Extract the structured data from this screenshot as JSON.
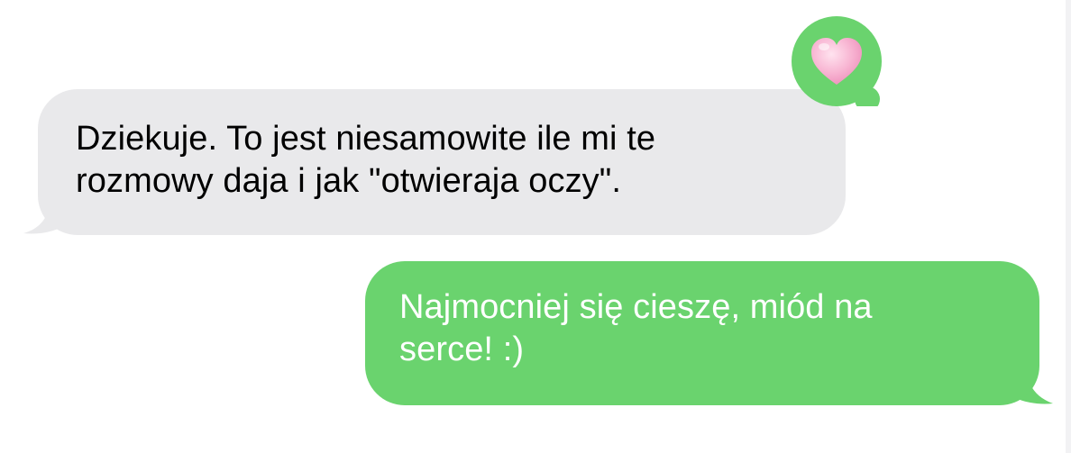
{
  "conversation": {
    "incoming_message": {
      "lines": [
        "Dziekuje. To jest niesamowite ile mi te",
        "rozmowy daja i jak \"otwieraja oczy\"."
      ],
      "bubble_color": "#e9e9eb",
      "text_color": "#000000"
    },
    "outgoing_message": {
      "lines": [
        "Najmocniej się cieszę, miód na",
        "serce! :)"
      ],
      "bubble_color": "#6ad36e",
      "text_color": "#ffffff"
    },
    "tapback": {
      "icon": "pink-heart-icon",
      "bubble_color": "#6ad36e",
      "heart_color": "#f7b4d2"
    }
  }
}
